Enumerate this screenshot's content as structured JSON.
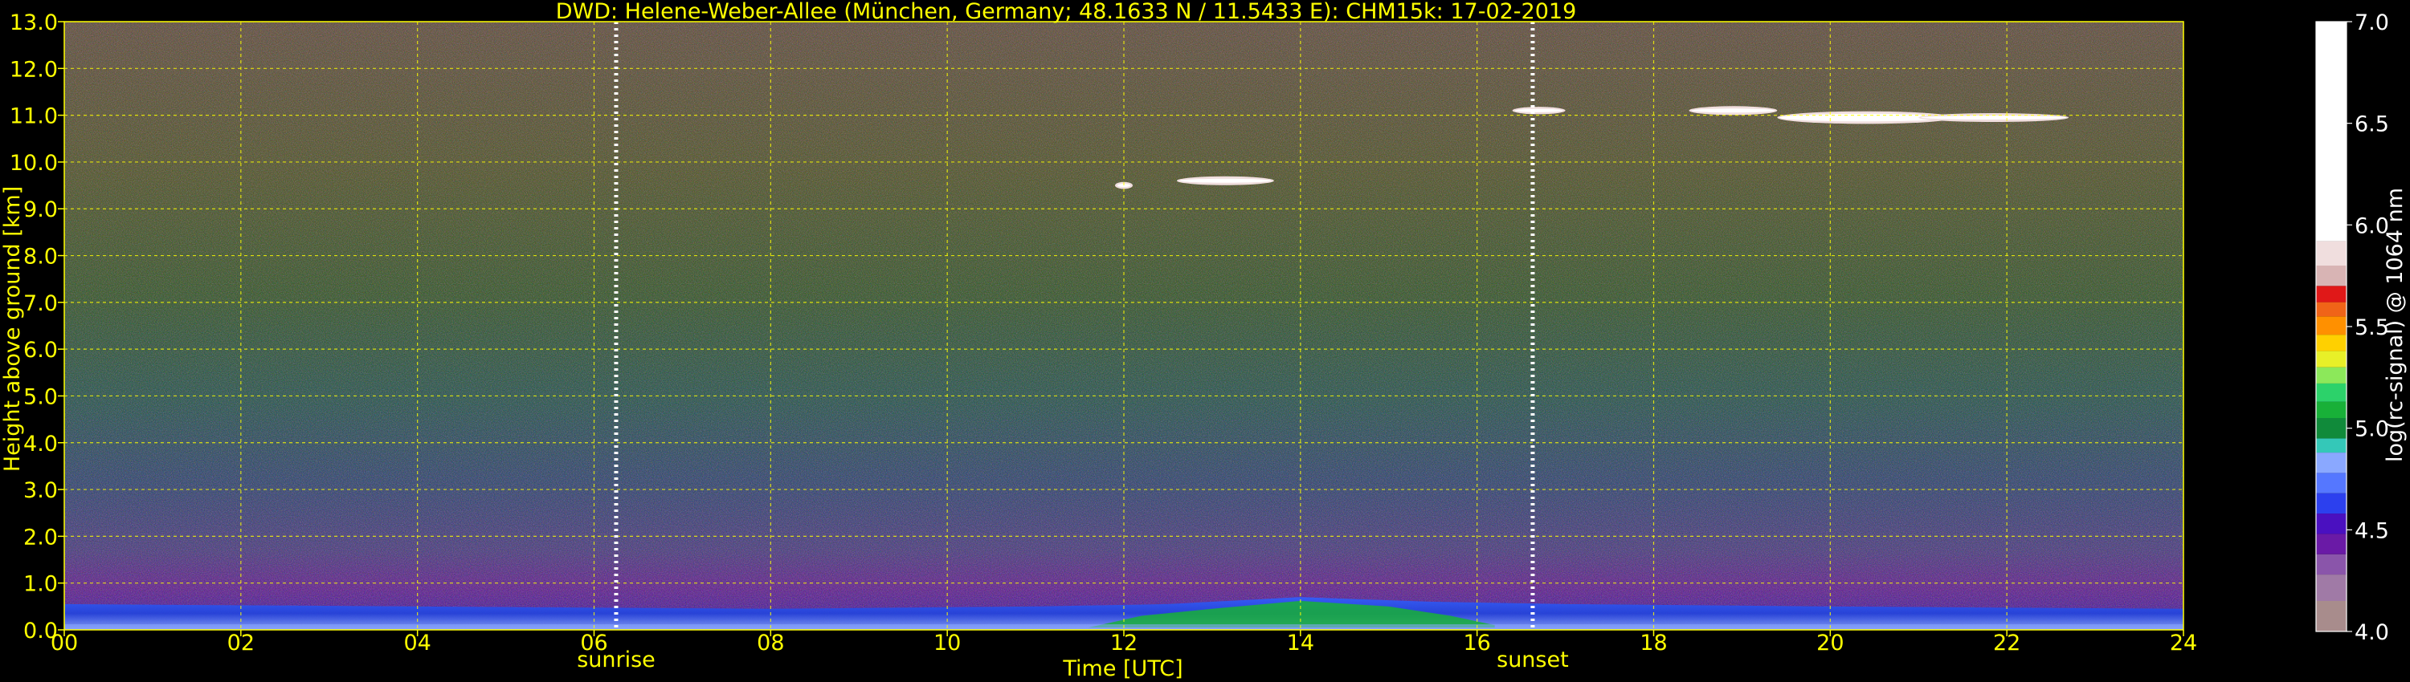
{
  "chart_data": {
    "type": "heatmap",
    "title": "DWD: Helene-Weber-Allee (München, Germany; 48.1633 N / 11.5433 E):    CHM15k: 17-02-2019",
    "xlabel": "Time [UTC]",
    "ylabel": "Height above ground [km]",
    "xlim": [
      0,
      24
    ],
    "ylim": [
      0,
      13
    ],
    "x_ticks": [
      0,
      2,
      4,
      6,
      8,
      10,
      12,
      14,
      16,
      18,
      20,
      22,
      24
    ],
    "x_tick_labels": [
      "00",
      "02",
      "04",
      "06",
      "08",
      "10",
      "12",
      "14",
      "16",
      "18",
      "20",
      "22",
      "24"
    ],
    "y_ticks": [
      0,
      1,
      2,
      3,
      4,
      5,
      6,
      7,
      8,
      9,
      10,
      11,
      12,
      13
    ],
    "y_tick_labels": [
      "0.0",
      "1.0",
      "2.0",
      "3.0",
      "4.0",
      "5.0",
      "6.0",
      "7.0",
      "8.0",
      "9.0",
      "10.0",
      "11.0",
      "12.0",
      "13.0"
    ],
    "grid": true,
    "markers": [
      {
        "label": "sunrise",
        "time": 6.25
      },
      {
        "label": "sunset",
        "time": 16.63
      }
    ],
    "colorbar": {
      "label": "log(rc-signal) @ 1064 nm",
      "range": [
        4.0,
        7.0
      ],
      "ticks": [
        4.0,
        4.5,
        5.0,
        5.5,
        6.0,
        6.5,
        7.0
      ],
      "tick_labels": [
        "4.0",
        "4.5",
        "5.0",
        "5.5",
        "6.0",
        "6.5",
        "7.0"
      ],
      "bands": [
        {
          "from": 4.0,
          "to": 4.15,
          "color": "#a88c8c"
        },
        {
          "from": 4.15,
          "to": 4.28,
          "color": "#a07aa6"
        },
        {
          "from": 4.28,
          "to": 4.38,
          "color": "#8a55aa"
        },
        {
          "from": 4.38,
          "to": 4.48,
          "color": "#6a1aa6"
        },
        {
          "from": 4.48,
          "to": 4.58,
          "color": "#4a10c0"
        },
        {
          "from": 4.58,
          "to": 4.68,
          "color": "#2c40ee"
        },
        {
          "from": 4.68,
          "to": 4.78,
          "color": "#5577ff"
        },
        {
          "from": 4.78,
          "to": 4.88,
          "color": "#8aa8ff"
        },
        {
          "from": 4.88,
          "to": 4.95,
          "color": "#34c8b8"
        },
        {
          "from": 4.95,
          "to": 5.05,
          "color": "#108a3a"
        },
        {
          "from": 5.05,
          "to": 5.13,
          "color": "#18b038"
        },
        {
          "from": 5.13,
          "to": 5.22,
          "color": "#2cd26a"
        },
        {
          "from": 5.22,
          "to": 5.3,
          "color": "#8ce85a"
        },
        {
          "from": 5.3,
          "to": 5.38,
          "color": "#e8f028"
        },
        {
          "from": 5.38,
          "to": 5.46,
          "color": "#ffd000"
        },
        {
          "from": 5.46,
          "to": 5.55,
          "color": "#ff9000"
        },
        {
          "from": 5.55,
          "to": 5.62,
          "color": "#f06418"
        },
        {
          "from": 5.62,
          "to": 5.7,
          "color": "#e01818"
        },
        {
          "from": 5.7,
          "to": 5.8,
          "color": "#d8b4b4"
        },
        {
          "from": 5.8,
          "to": 5.92,
          "color": "#f0dede"
        },
        {
          "from": 5.92,
          "to": 7.0,
          "color": "#ffffff"
        }
      ]
    },
    "cloud_layers": [
      {
        "t_start": 11.9,
        "t_end": 12.1,
        "height": 9.5,
        "thickness": 0.08
      },
      {
        "t_start": 12.6,
        "t_end": 13.7,
        "height": 9.6,
        "thickness": 0.12
      },
      {
        "t_start": 16.4,
        "t_end": 17.0,
        "height": 11.1,
        "thickness": 0.09
      },
      {
        "t_start": 18.4,
        "t_end": 19.4,
        "height": 11.1,
        "thickness": 0.12
      },
      {
        "t_start": 19.4,
        "t_end": 21.4,
        "height": 10.95,
        "thickness": 0.2
      },
      {
        "t_start": 21.0,
        "t_end": 22.7,
        "height": 10.95,
        "thickness": 0.12
      }
    ],
    "boundary_layer": [
      {
        "t": 0,
        "top": 0.55
      },
      {
        "t": 4,
        "top": 0.5
      },
      {
        "t": 8,
        "top": 0.45
      },
      {
        "t": 11,
        "top": 0.5
      },
      {
        "t": 12.5,
        "top": 0.55
      },
      {
        "t": 14,
        "top": 0.7
      },
      {
        "t": 15.5,
        "top": 0.6
      },
      {
        "t": 17,
        "top": 0.55
      },
      {
        "t": 20,
        "top": 0.5
      },
      {
        "t": 24,
        "top": 0.45
      }
    ]
  }
}
